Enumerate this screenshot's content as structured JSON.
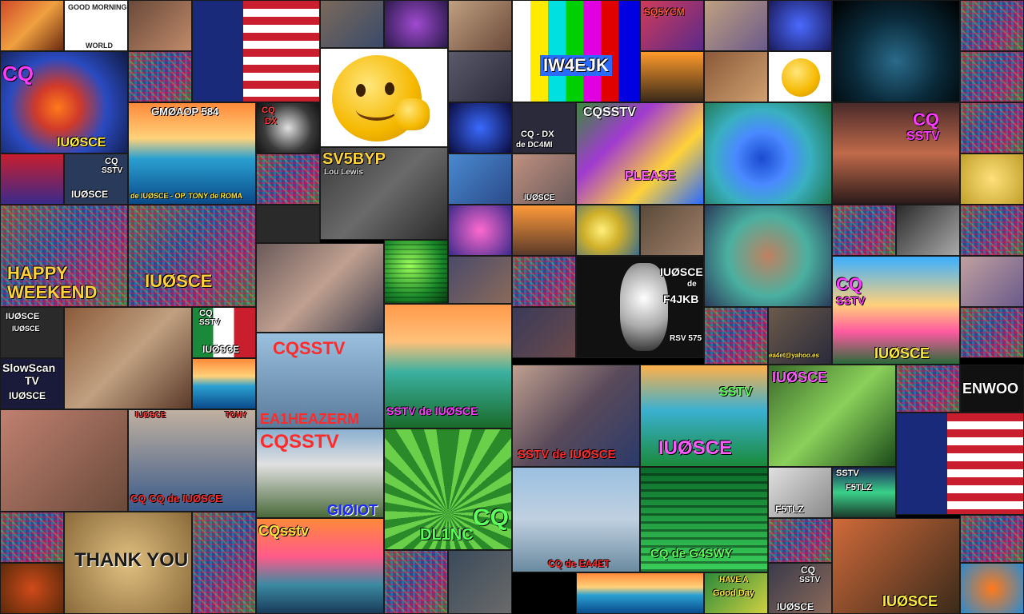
{
  "tiles": {
    "good_morning": {
      "line1": "GOOD MORNING",
      "line2": "WORLD"
    },
    "cq_fish": {
      "cq": "CQ",
      "call": "IUØSCE"
    },
    "gm0aop": {
      "title": "GMØAOP 584",
      "footer": "de IUØSCE - OP. TONY de ROMA"
    },
    "cq_dx_skull": {
      "line1": "CQ",
      "line2": "DX"
    },
    "smiley": {},
    "sv5byp": {
      "call": "SV5BYP",
      "sub": "Lou Lewis"
    },
    "iw4ejk": {
      "call": "IW4EJK"
    },
    "cq_dx_dc4mi": {
      "line1": "CQ - DX",
      "line2": "de DC4MI",
      "footer": "IUØSCE"
    },
    "cqsstv_please": {
      "top": "CQSSTV",
      "bottom": "PLEASE"
    },
    "cq_sstv_colosseum": {
      "cq": "CQ",
      "sstv": "SSTV"
    },
    "happy_weekend": {
      "line1": "HAPPY",
      "line2": "WEEKEND"
    },
    "iu0sce_center": {
      "call": "IUØSCE"
    },
    "iu0sce_iu0sce": {
      "a": "IUØSCE",
      "b": "IUØSCE"
    },
    "cq_sstv_flag": {
      "cq": "CQ",
      "sstv": "SSTV",
      "call": "IUØSCE"
    },
    "slowscan": {
      "line1": "SlowScan",
      "line2": "TV",
      "call": "IUØSCE"
    },
    "cqsstv_gorilla": {
      "title": "CQSSTV",
      "sub": "EA1HEAZERM"
    },
    "cqsstv_van": {
      "title": "CQSSTV",
      "call": "GIØIOT"
    },
    "cq_de_iu0sce": {
      "header_left": "IUØSCE",
      "header_right": "TONY",
      "text": "CQ CQ de IUØSCE"
    },
    "f4jkb": {
      "call": "IUØSCE",
      "de": "de",
      "dest": "F4JKB",
      "rsv": "RSV 575"
    },
    "sstv_de_iu0sce": {
      "text": "SSTV de IUØSCE"
    },
    "iu0sce_waterfall": {
      "call": "IUØSCE",
      "sstv": "SSTV"
    },
    "iu0sce_jungle": {
      "call": "IUØSCE"
    },
    "parrot_iu0sce": {
      "text": "SSTV de IUØSCE"
    },
    "cq_sstv_beach": {
      "cq": "CQ",
      "sstv": "SSTV",
      "call": "IUØSCE"
    },
    "thank_you": {
      "text": "THANK YOU"
    },
    "cqsstv_sunset": {
      "title": "CQsstv"
    },
    "dl1nc": {
      "cq": "CQ",
      "call": "DL1NC"
    },
    "cq_de_ea4et": {
      "text": "CQ de EA4ET"
    },
    "cq_de_green": {
      "text": "CQ de G4SWY"
    },
    "f5tlz": {
      "call": "F5TLZ"
    },
    "sstv_f5tlz": {
      "sstv": "SSTV",
      "call": "F5TLZ"
    },
    "have_good_day": {
      "line1": "HAVE A",
      "line2": "Good Day"
    },
    "cq_sstv_bottom": {
      "cq": "CQ",
      "sstv": "SSTV",
      "call": "IUØSCE"
    },
    "iu0sce_bottom": {
      "call": "IUØSCE"
    },
    "kenwood": {
      "text": "ENWOO"
    },
    "sq5ycm": {
      "call": "SQ5YCM"
    },
    "iu0sce_sstv_small": {
      "call": "IUØSCE"
    },
    "cq_sstv_small": {
      "cq": "CQ",
      "sstv": "SSTV"
    },
    "mail": {
      "text": "ea4et@yahoo.es"
    }
  }
}
